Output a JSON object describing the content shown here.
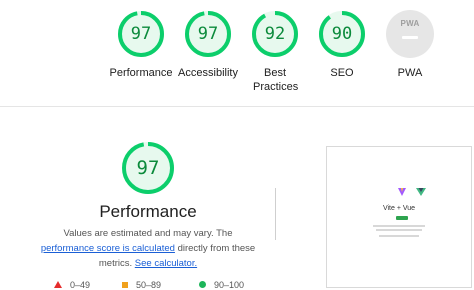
{
  "categories": [
    {
      "key": "performance",
      "score": "97",
      "label": "Performance",
      "progress": 0.97
    },
    {
      "key": "accessibility",
      "score": "97",
      "label": "Accessibility",
      "progress": 0.97
    },
    {
      "key": "best_practices",
      "score": "92",
      "label": "Best Practices",
      "progress": 0.92
    },
    {
      "key": "seo",
      "score": "90",
      "label": "SEO",
      "progress": 0.9
    }
  ],
  "pwa": {
    "badge_text": "PWA",
    "label": "PWA"
  },
  "colors": {
    "pass_green": "#0cce6b",
    "pass_text": "#0b8a3b",
    "average": "#f0a11d",
    "fail": "#e52d2d",
    "link": "#1a5fd6"
  },
  "detail": {
    "score": "97",
    "progress": 0.97,
    "title": "Performance",
    "description_prefix": "Values are estimated and may vary. The ",
    "link1": "performance score is calculated",
    "description_mid": " directly from these metrics. ",
    "link2": "See calculator."
  },
  "legend": [
    {
      "shape": "triangle",
      "range": "0–49"
    },
    {
      "shape": "square",
      "range": "50–89"
    },
    {
      "shape": "circle",
      "range": "90–100"
    }
  ],
  "screenshot_thumb": {
    "title": "Vite + Vue"
  }
}
